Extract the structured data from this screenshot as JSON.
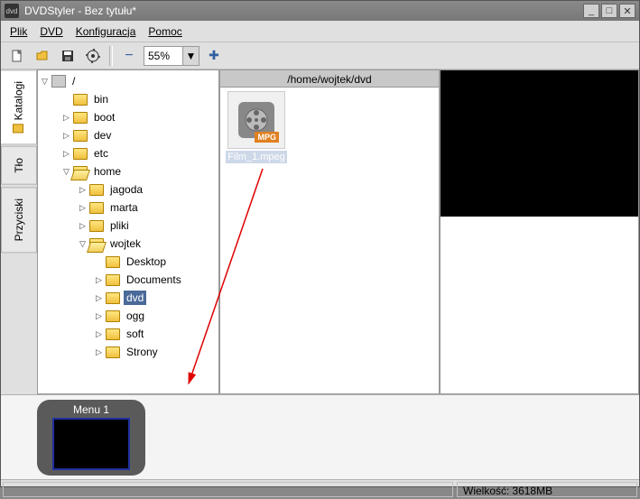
{
  "window": {
    "title": "DVDStyler - Bez tytułu*"
  },
  "menu": {
    "file": "Plik",
    "dvd": "DVD",
    "config": "Konfiguracja",
    "help": "Pomoc"
  },
  "toolbar": {
    "zoom": "55%"
  },
  "tabs": {
    "catalogs": "Katalogi",
    "background": "Tło",
    "buttons": "Przyciski"
  },
  "tree": {
    "root": "/",
    "nodes": [
      {
        "indent": 1,
        "expand": "none",
        "label": "bin"
      },
      {
        "indent": 1,
        "expand": "closed",
        "label": "boot"
      },
      {
        "indent": 1,
        "expand": "closed",
        "label": "dev"
      },
      {
        "indent": 1,
        "expand": "closed",
        "label": "etc"
      },
      {
        "indent": 1,
        "expand": "open",
        "label": "home",
        "open": true
      },
      {
        "indent": 2,
        "expand": "closed",
        "label": "jagoda"
      },
      {
        "indent": 2,
        "expand": "closed",
        "label": "marta"
      },
      {
        "indent": 2,
        "expand": "closed",
        "label": "pliki"
      },
      {
        "indent": 2,
        "expand": "open",
        "label": "wojtek",
        "open": true
      },
      {
        "indent": 3,
        "expand": "none",
        "label": "Desktop"
      },
      {
        "indent": 3,
        "expand": "closed",
        "label": "Documents"
      },
      {
        "indent": 3,
        "expand": "closed",
        "label": "dvd",
        "selected": true
      },
      {
        "indent": 3,
        "expand": "closed",
        "label": "ogg"
      },
      {
        "indent": 3,
        "expand": "closed",
        "label": "soft"
      },
      {
        "indent": 3,
        "expand": "closed",
        "label": "Strony"
      }
    ]
  },
  "path": "/home/wojtek/dvd",
  "files": {
    "item1": "Film_1.mpeg",
    "badge": "MPG"
  },
  "timeline": {
    "menu1": "Menu 1"
  },
  "status": {
    "size_label": "Wielkość:",
    "size_value": "3618MB"
  }
}
